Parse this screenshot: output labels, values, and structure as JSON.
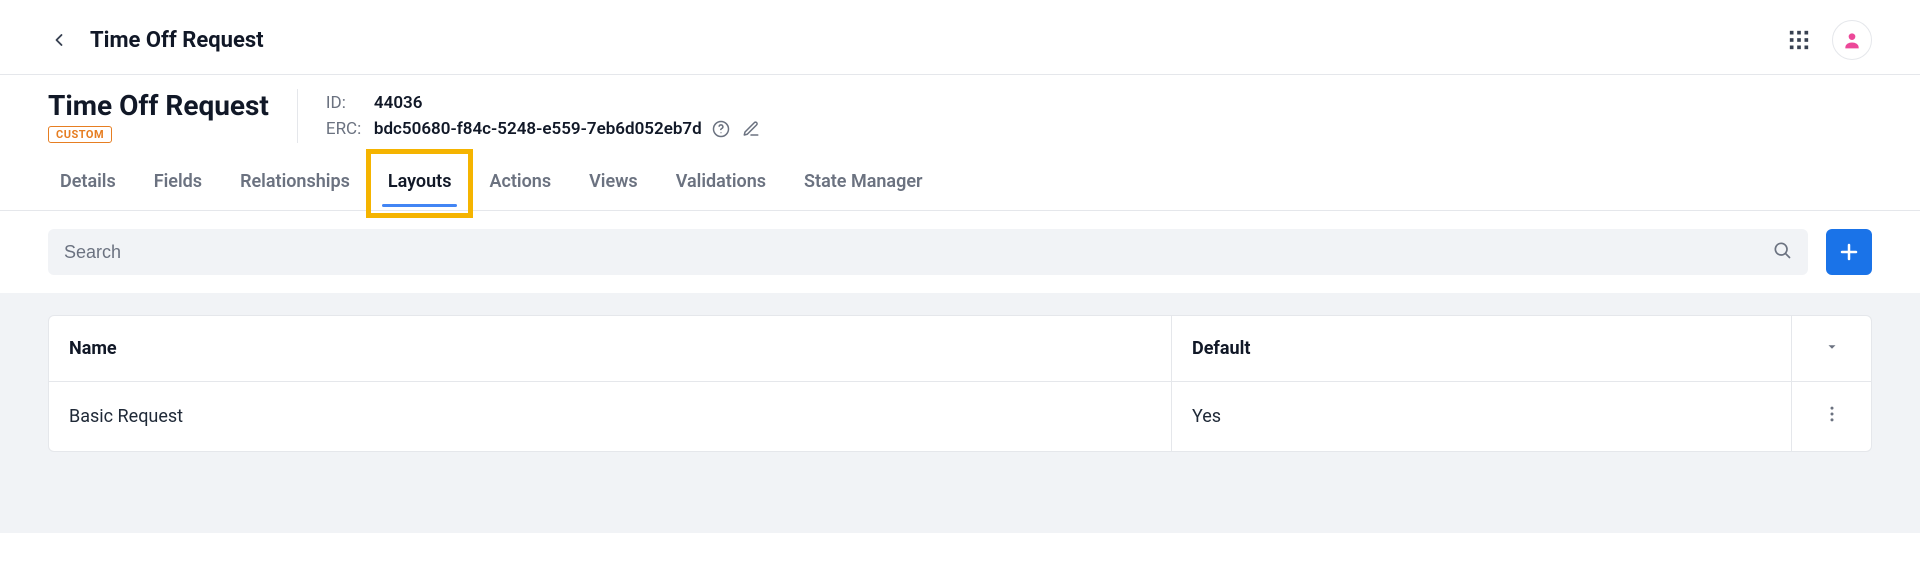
{
  "topbar": {
    "title": "Time Off Request"
  },
  "object": {
    "title": "Time Off Request",
    "badge": "CUSTOM",
    "id_label": "ID:",
    "id_value": "44036",
    "erc_label": "ERC:",
    "erc_value": "bdc50680-f84c-5248-e559-7eb6d052eb7d"
  },
  "tabs": {
    "items": [
      {
        "label": "Details",
        "active": false
      },
      {
        "label": "Fields",
        "active": false
      },
      {
        "label": "Relationships",
        "active": false
      },
      {
        "label": "Layouts",
        "active": true
      },
      {
        "label": "Actions",
        "active": false
      },
      {
        "label": "Views",
        "active": false
      },
      {
        "label": "Validations",
        "active": false
      },
      {
        "label": "State Manager",
        "active": false
      }
    ]
  },
  "search": {
    "placeholder": "Search"
  },
  "table": {
    "columns": {
      "name": "Name",
      "default": "Default"
    },
    "rows": [
      {
        "name": "Basic Request",
        "default": "Yes"
      }
    ]
  }
}
